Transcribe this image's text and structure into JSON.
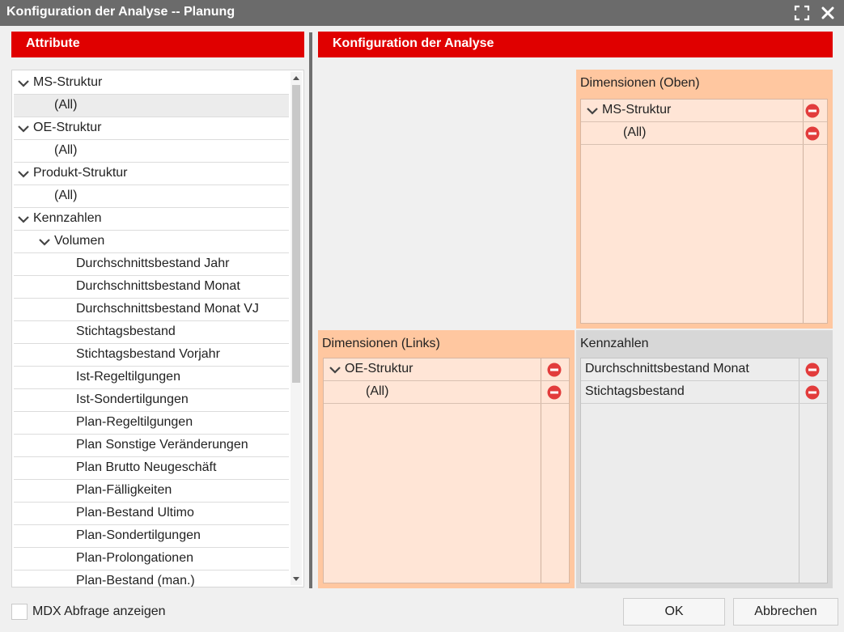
{
  "window": {
    "title": "Konfiguration der Analyse -- Planung"
  },
  "attributes_panel": {
    "header": "Attribute",
    "items": [
      {
        "label": "MS-Struktur",
        "level": 0,
        "expanded": true
      },
      {
        "label": "(All)",
        "level": 1,
        "selected": true
      },
      {
        "label": "OE-Struktur",
        "level": 0,
        "expanded": true
      },
      {
        "label": "(All)",
        "level": 1
      },
      {
        "label": "Produkt-Struktur",
        "level": 0,
        "expanded": true
      },
      {
        "label": "(All)",
        "level": 1
      },
      {
        "label": "Kennzahlen",
        "level": 0,
        "expanded": true
      },
      {
        "label": "Volumen",
        "level": 1,
        "expanded": true
      },
      {
        "label": "Durchschnittsbestand Jahr",
        "level": 2
      },
      {
        "label": "Durchschnittsbestand Monat",
        "level": 2
      },
      {
        "label": "Durchschnittsbestand Monat VJ",
        "level": 2
      },
      {
        "label": "Stichtagsbestand",
        "level": 2
      },
      {
        "label": "Stichtagsbestand Vorjahr",
        "level": 2
      },
      {
        "label": "Ist-Regeltilgungen",
        "level": 2
      },
      {
        "label": "Ist-Sondertilgungen",
        "level": 2
      },
      {
        "label": "Plan-Regeltilgungen",
        "level": 2
      },
      {
        "label": "Plan Sonstige Veränderungen",
        "level": 2
      },
      {
        "label": "Plan Brutto Neugeschäft",
        "level": 2
      },
      {
        "label": "Plan-Fälligkeiten",
        "level": 2
      },
      {
        "label": "Plan-Bestand Ultimo",
        "level": 2
      },
      {
        "label": "Plan-Sondertilgungen",
        "level": 2
      },
      {
        "label": "Plan-Prolongationen",
        "level": 2
      },
      {
        "label": "Plan-Bestand (man.)",
        "level": 2
      }
    ]
  },
  "config_panel": {
    "header": "Konfiguration der Analyse",
    "zones": {
      "top": {
        "title": "Dimensionen (Oben)",
        "items": [
          {
            "label": "MS-Struktur",
            "level": 0,
            "expanded": true
          },
          {
            "label": "(All)",
            "level": 1
          }
        ]
      },
      "left": {
        "title": "Dimensionen (Links)",
        "items": [
          {
            "label": "OE-Struktur",
            "level": 0,
            "expanded": true
          },
          {
            "label": "(All)",
            "level": 1
          }
        ]
      },
      "measures": {
        "title": "Kennzahlen",
        "items": [
          {
            "label": "Durchschnittsbestand Monat",
            "level": 0
          },
          {
            "label": "Stichtagsbestand",
            "level": 0
          }
        ]
      }
    }
  },
  "footer": {
    "checkbox_label": "MDX Abfrage anzeigen",
    "checkbox_checked": false,
    "ok_label": "OK",
    "cancel_label": "Abbrechen"
  },
  "colors": {
    "header_red": "#e00000",
    "zone_orange": "#ffc7a0",
    "zone_light": "#ffe5d6",
    "zone_grey": "#d7d7d7",
    "zone_grey_light": "#ececec",
    "remove_red": "#e23c3c",
    "titlebar": "#6b6b6b"
  }
}
